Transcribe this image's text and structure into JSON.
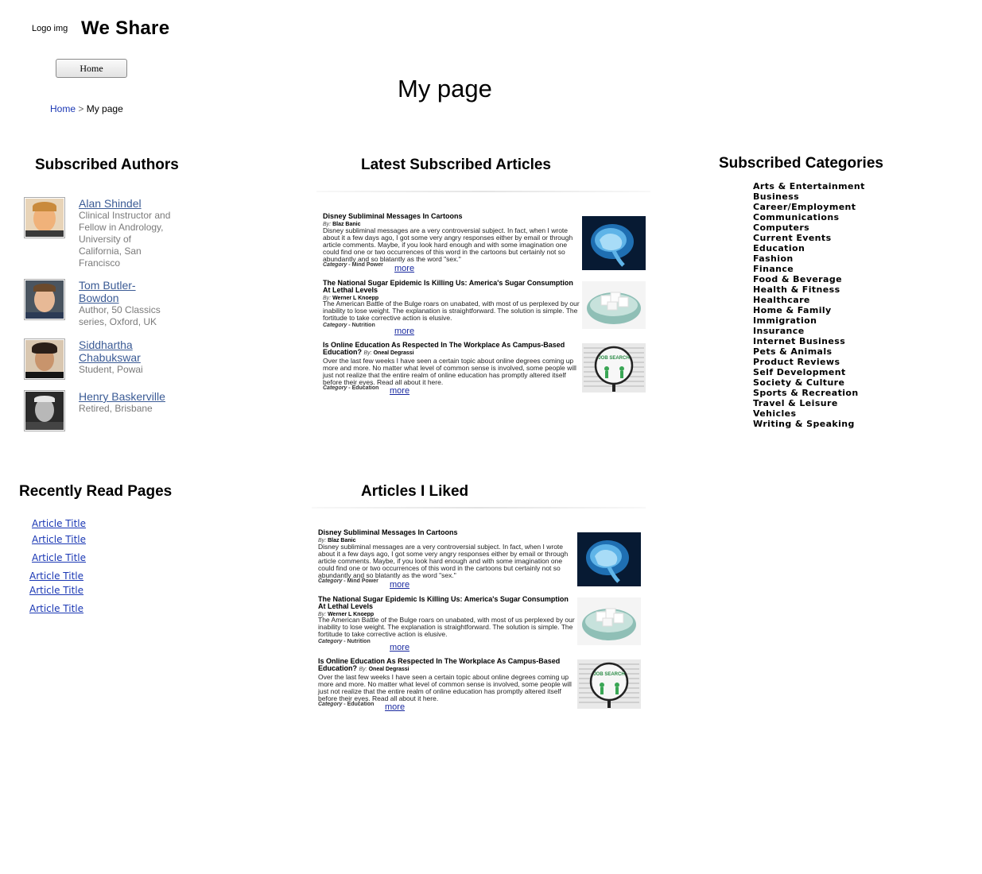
{
  "header": {
    "logo_text": "Logo img",
    "site_title": "We Share",
    "home_button": "Home",
    "page_title": "My page",
    "breadcrumb": {
      "home": "Home",
      "separator": ">",
      "current": "My page"
    }
  },
  "sections": {
    "subscribed_authors": "Subscribed Authors",
    "latest_articles": "Latest Subscribed Articles",
    "subscribed_categories": "Subscribed Categories",
    "recently_read": "Recently Read Pages",
    "articles_liked": "Articles I Liked"
  },
  "authors": [
    {
      "name": "Alan Shindel",
      "desc": "Clinical Instructor and Fellow in Andrology, University of California, San Francisco"
    },
    {
      "name": "Tom Butler-Bowdon",
      "desc": "Author, 50 Classics series, Oxford, UK"
    },
    {
      "name": "Siddhartha Chabukswar",
      "desc": "Student, Powai"
    },
    {
      "name": "Henry Baskerville",
      "desc": "Retired, Brisbane"
    }
  ],
  "articles": [
    {
      "title": "Disney Subliminal Messages In Cartoons",
      "by": "By:",
      "author": "Blaz Banic",
      "body": "Disney subliminal messages are a very controversial subject. In fact, when I wrote about it a few days ago, I got some very angry responses either by email or through article comments. Maybe, if you look hard enough and with some imagination one could find one or two occurrences of this word in the cartoons but certainly not so abundantly and so blatantly as the word \"sex.\"",
      "category_label": "Category",
      "category": "- Mind Power",
      "more": "more",
      "thumb": "brain-scan"
    },
    {
      "title": "The National Sugar Epidemic Is Killing Us: America's Sugar Consumption At Lethal Levels",
      "by": "By:",
      "author": "Werner L Knoepp",
      "body": "The American Battle of the Bulge roars on unabated, with most of us perplexed by our inability to lose weight. The explanation is straightforward. The solution is simple. The fortitude to take corrective action is elusive.",
      "category_label": "Category",
      "category": "- Nutrition",
      "more": "more",
      "thumb": "sugar-cubes"
    },
    {
      "title": "Is Online Education As Respected In The Workplace As Campus-Based Education?",
      "by": "By:",
      "author": "Oneal Degrassi",
      "body": "Over the last few weeks I have seen a certain topic about online degrees coming up more and more. No matter what level of common sense is involved, some people will just not realize that the entire realm of online education has promptly altered itself before their eyes. Read all about it here.",
      "category_label": "Category",
      "category": "- Education",
      "more": "more",
      "thumb": "job-search",
      "thumb_text": "JOB SEARCH"
    }
  ],
  "categories": [
    "Arts & Entertainment",
    "Business",
    "Career/Employment",
    "Communications",
    "Computers",
    "Current Events",
    "Education",
    "Fashion",
    "Finance",
    "Food & Beverage",
    "Health & Fitness",
    "Healthcare",
    "Home & Family",
    "Immigration",
    "Insurance",
    "Internet Business",
    "Pets & Animals",
    "Product Reviews",
    "Self Development",
    "Society & Culture",
    "Sports & Recreation",
    "Travel & Leisure",
    "Vehicles",
    "Writing & Speaking"
  ],
  "recently_read": [
    "Article Title",
    "Article Title",
    "Article Title",
    "Article Title",
    "Article Title",
    "Article Title"
  ],
  "colors": {
    "link": "#1a37b4",
    "author_link": "#3b5b95",
    "muted": "#7a7a7a"
  }
}
